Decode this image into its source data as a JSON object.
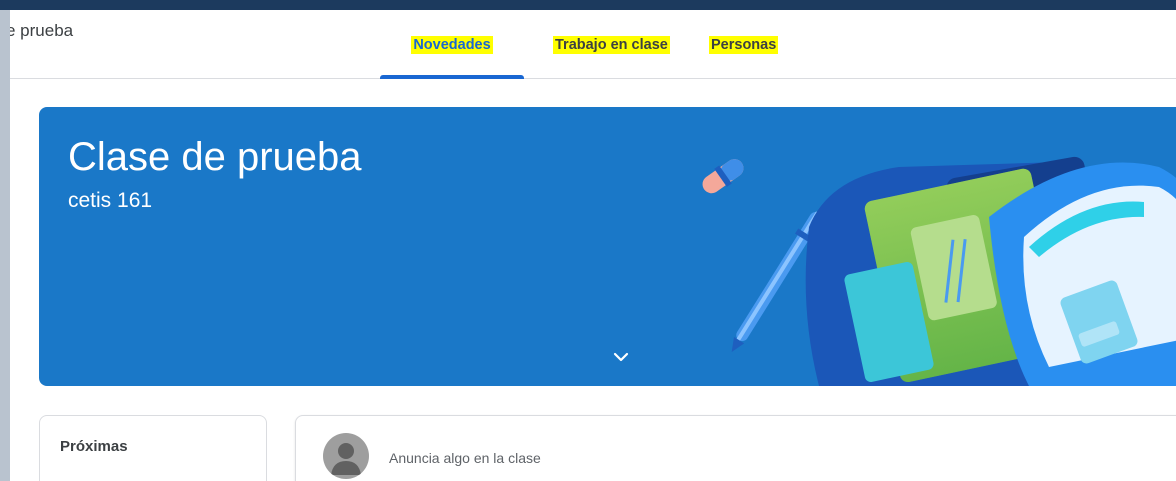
{
  "header": {
    "class_name": "e prueba"
  },
  "tabs": [
    {
      "label": "Novedades",
      "active": true
    },
    {
      "label": "Trabajo en clase",
      "active": false
    },
    {
      "label": "Personas",
      "active": false
    }
  ],
  "banner": {
    "title": "Clase de prueba",
    "subtitle": "cetis 161",
    "expand_icon": "chevron-down-icon"
  },
  "upcoming": {
    "title": "Próximas"
  },
  "announce": {
    "placeholder": "Anuncia algo en la clase",
    "avatar_icon": "user-avatar-icon"
  },
  "colors": {
    "accent": "#1967d2",
    "banner": "#1a78c8",
    "highlight": "#ffff00"
  }
}
